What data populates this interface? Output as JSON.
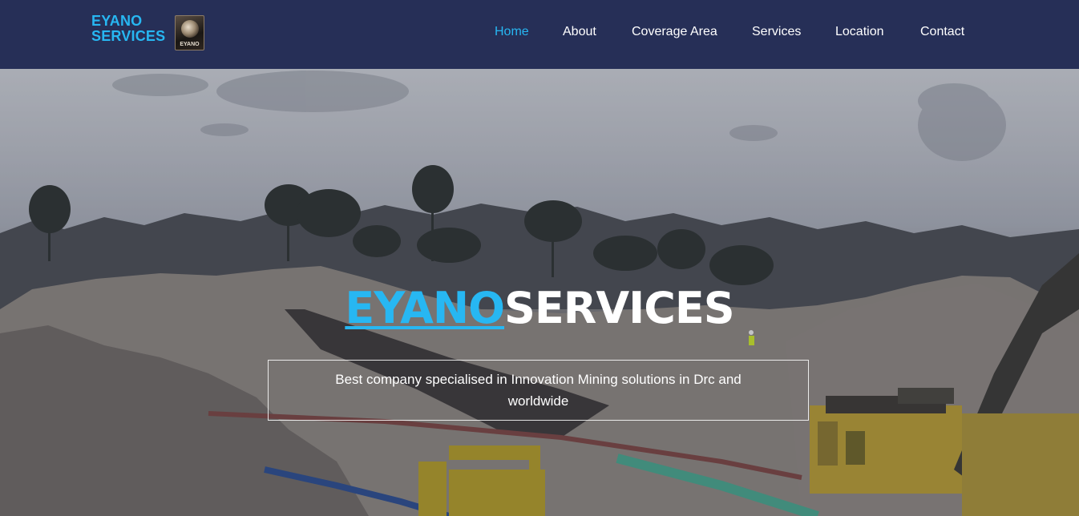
{
  "brand": {
    "line1": "EYANO",
    "line2": "SERVICES",
    "logo_text": "EYANO"
  },
  "nav": {
    "items": [
      {
        "label": "Home",
        "active": true
      },
      {
        "label": "About",
        "active": false
      },
      {
        "label": "Coverage Area",
        "active": false
      },
      {
        "label": "Services",
        "active": false
      },
      {
        "label": "Location",
        "active": false
      },
      {
        "label": "Contact",
        "active": false
      }
    ]
  },
  "hero": {
    "title_accent": "EYANO",
    "title_main": "SERVICES",
    "tagline": "Best company specialised in Innovation Mining solutions in Drc and worldwide",
    "background_icon": "mining-site-photo"
  },
  "colors": {
    "navbar": "#262f57",
    "accent": "#27b7f2",
    "text": "#ffffff"
  }
}
